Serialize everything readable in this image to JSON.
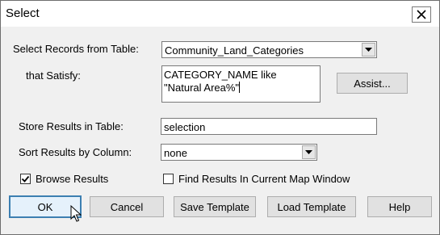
{
  "window": {
    "title": "Select"
  },
  "form": {
    "table_label": "Select Records from Table:",
    "table_value": "Community_Land_Categories",
    "satisfy_label": "that Satisfy:",
    "expression_lines": [
      "CATEGORY_NAME like",
      "\"Natural Area%\""
    ],
    "assist_button": "Assist...",
    "store_label": "Store Results in Table:",
    "store_value": "selection",
    "sort_label": "Sort Results by Column:",
    "sort_value": "none",
    "browse_label": "Browse Results",
    "browse_checked": true,
    "find_label": "Find Results In Current Map Window",
    "find_checked": false
  },
  "buttons": {
    "ok": "OK",
    "cancel": "Cancel",
    "save_template": "Save Template",
    "load_template": "Load Template",
    "help": "Help"
  },
  "icons": {
    "close": "close-icon",
    "dropdown": "chevron-down-icon",
    "check": "check-icon",
    "cursor": "mouse-cursor-icon"
  }
}
